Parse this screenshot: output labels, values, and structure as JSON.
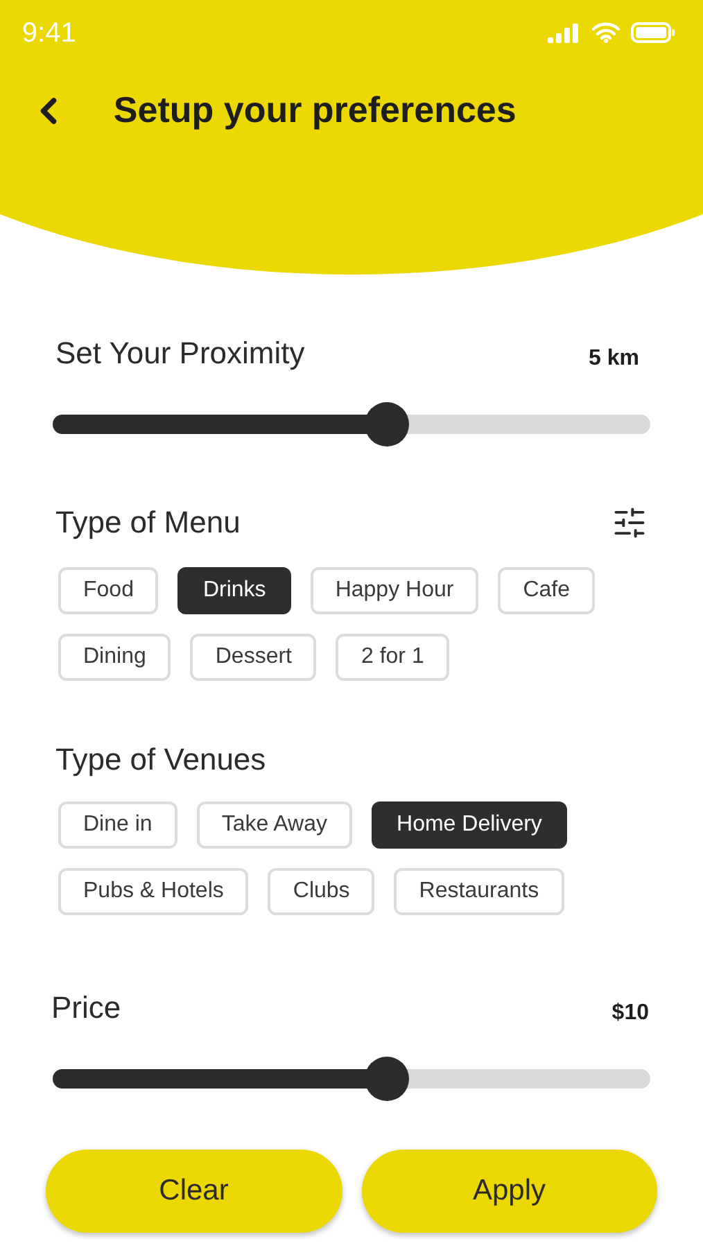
{
  "status_bar": {
    "time": "9:41"
  },
  "header": {
    "title": "Setup your preferences"
  },
  "proximity": {
    "label": "Set Your Proximity",
    "reading": "5 km",
    "level": 0.56
  },
  "menu_types": {
    "label": "Type of Menu",
    "chips": [
      {
        "label": "Food",
        "selected": false
      },
      {
        "label": "Drinks",
        "selected": true
      },
      {
        "label": "Happy Hour",
        "selected": false
      },
      {
        "label": "Cafe",
        "selected": false
      },
      {
        "label": "Dining",
        "selected": false
      },
      {
        "label": "Dessert",
        "selected": false
      },
      {
        "label": "2 for 1",
        "selected": false
      }
    ]
  },
  "venue_types": {
    "label": "Type of Venues",
    "chips": [
      {
        "label": "Dine in",
        "selected": false
      },
      {
        "label": "Take Away",
        "selected": false
      },
      {
        "label": "Home Delivery",
        "selected": true
      },
      {
        "label": "Pubs & Hotels",
        "selected": false
      },
      {
        "label": "Clubs",
        "selected": false
      },
      {
        "label": "Restaurants",
        "selected": false
      }
    ]
  },
  "price": {
    "label": "Price",
    "reading": "$10",
    "level": 0.56
  },
  "buttons": [
    "Clear",
    "Apply"
  ]
}
